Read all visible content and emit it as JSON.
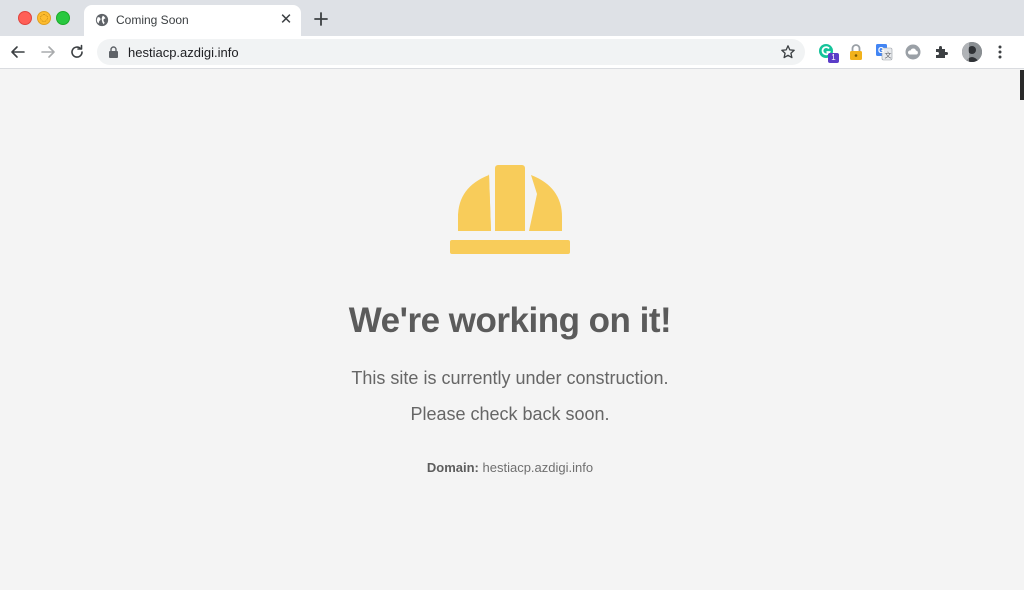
{
  "browser": {
    "tab": {
      "title": "Coming Soon",
      "favicon": "globe-icon"
    },
    "address_bar": {
      "url": "hestiacp.azdigi.info",
      "secure": true
    },
    "extensions": [
      {
        "name": "grammarly-extension-icon",
        "badge": "1"
      },
      {
        "name": "password-lock-extension-icon"
      },
      {
        "name": "translate-extension-icon"
      },
      {
        "name": "cloud-extension-icon"
      },
      {
        "name": "puzzle-extensions-icon"
      }
    ]
  },
  "page": {
    "icon": "hard-hat-icon",
    "icon_color": "#f8cc5a",
    "headline": "We're working on it!",
    "line1": "This site is currently under construction.",
    "line2": "Please check back soon.",
    "domain_label": "Domain:",
    "domain_value": "hestiacp.azdigi.info"
  }
}
